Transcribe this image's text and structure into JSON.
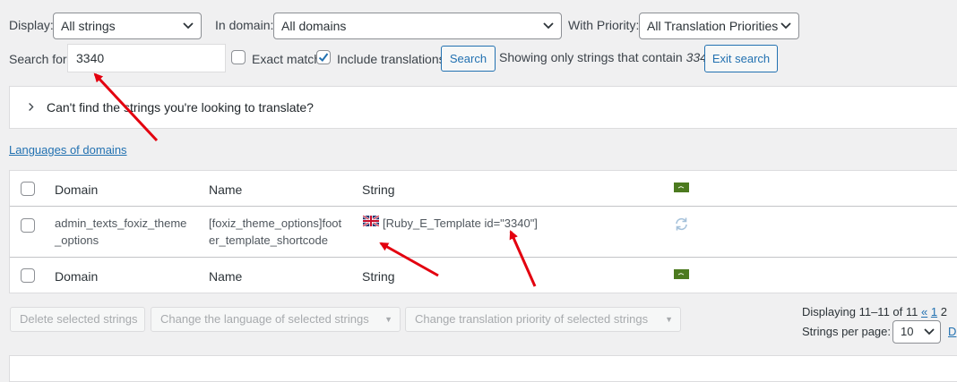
{
  "filters": {
    "display_label": "Display:",
    "display_value": "All strings",
    "domain_label": "In domain:",
    "domain_value": "All domains",
    "priority_label": "With Priority:",
    "priority_value": "All Translation Priorities",
    "search_label": "Search for:",
    "search_value": "3340",
    "exact_match_label": "Exact match",
    "include_translations_label": "Include translations",
    "search_button": "Search",
    "showing_prefix": "Showing only strings that contain",
    "showing_term": "3340",
    "exit_search_button": "Exit search"
  },
  "help_panel": {
    "text": "Can't find the strings you're looking to translate?"
  },
  "languages_link": "Languages of domains",
  "table": {
    "headers": {
      "domain": "Domain",
      "name": "Name",
      "string": "String"
    },
    "rows": [
      {
        "domain": "admin_texts_foxiz_theme_options",
        "name": "[foxiz_theme_options]footer_template_shortcode",
        "string": "[Ruby_E_Template id=\"3340\"]"
      }
    ],
    "footer_headers": {
      "domain": "Domain",
      "name": "Name",
      "string": "String"
    }
  },
  "bulk_actions": {
    "delete": "Delete selected strings",
    "change_language": "Change the language of selected strings",
    "change_priority": "Change translation priority of selected strings"
  },
  "pagination": {
    "displaying": "Displaying 11–11 of 11",
    "prev": "«",
    "page_1": "1",
    "page_2": "2",
    "per_page_label": "Strings per page:",
    "per_page_value": "10",
    "cut_link": "D"
  },
  "colors": {
    "accent": "#2271b1",
    "annotation_arrow": "#e3000f",
    "flag_badge": "#4c7a1f"
  },
  "icons": [
    "chevron-down-icon",
    "chevron-right-icon",
    "checkmark-icon",
    "uk-flag-icon",
    "sync-icon",
    "language-flag-icon"
  ]
}
